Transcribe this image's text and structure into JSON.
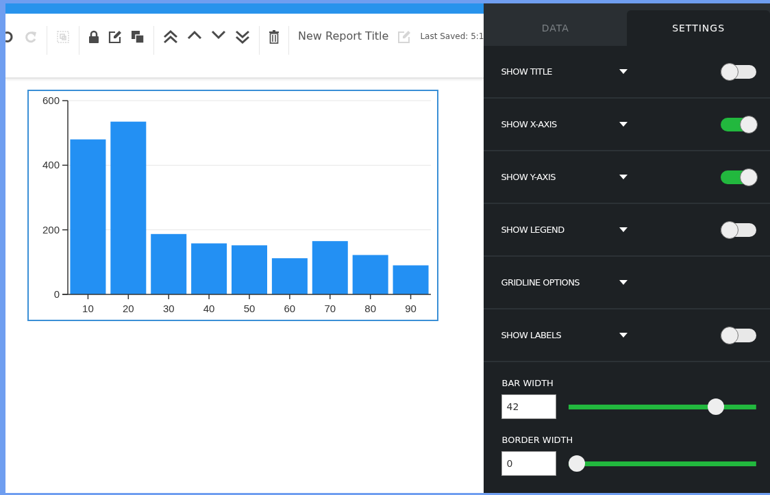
{
  "toolbar": {
    "buttons": [
      {
        "kind": "undo",
        "disabled": false
      },
      {
        "kind": "redo",
        "disabled": true
      },
      {
        "kind": "select",
        "disabled": true
      },
      {
        "kind": "lock",
        "disabled": false
      },
      {
        "kind": "edit",
        "disabled": false
      },
      {
        "kind": "copy",
        "disabled": false
      },
      {
        "kind": "top",
        "disabled": false
      },
      {
        "kind": "up",
        "disabled": false
      },
      {
        "kind": "down",
        "disabled": false
      },
      {
        "kind": "bottom",
        "disabled": false
      },
      {
        "kind": "trash",
        "disabled": false
      }
    ],
    "title": "New Report Title",
    "title_edit_disabled": true,
    "last_saved": "Last Saved: 5:1"
  },
  "chart": {
    "chart_data": {
      "type": "bar",
      "categories": [
        "10",
        "20",
        "30",
        "40",
        "50",
        "60",
        "70",
        "80",
        "90"
      ],
      "series": [
        {
          "color": "#2390f3",
          "values": [
            480,
            535,
            187,
            158,
            152,
            112,
            165,
            122,
            90
          ]
        }
      ],
      "ylim": [
        0,
        600
      ],
      "yticks": [
        0,
        200,
        400,
        600
      ]
    }
  },
  "panel": {
    "tabs": [
      {
        "label": "DATA",
        "selected": false
      },
      {
        "label": "SETTINGS",
        "selected": true
      }
    ],
    "rows": [
      {
        "kind": "toggle",
        "label": "SHOW TITLE",
        "on": false
      },
      {
        "kind": "toggle",
        "label": "SHOW X-AXIS",
        "on": true
      },
      {
        "kind": "toggle",
        "label": "SHOW Y-AXIS",
        "on": true
      },
      {
        "kind": "toggle",
        "label": "SHOW LEGEND",
        "on": false
      },
      {
        "kind": "dropdown",
        "label": "GRIDLINE OPTIONS"
      },
      {
        "kind": "toggle",
        "label": "SHOW LABELS",
        "on": false
      }
    ],
    "sliders": [
      {
        "label": "BAR WIDTH",
        "value": "42",
        "level": 0.81
      },
      {
        "label": "BORDER WIDTH",
        "value": "0",
        "level": 0
      }
    ]
  }
}
